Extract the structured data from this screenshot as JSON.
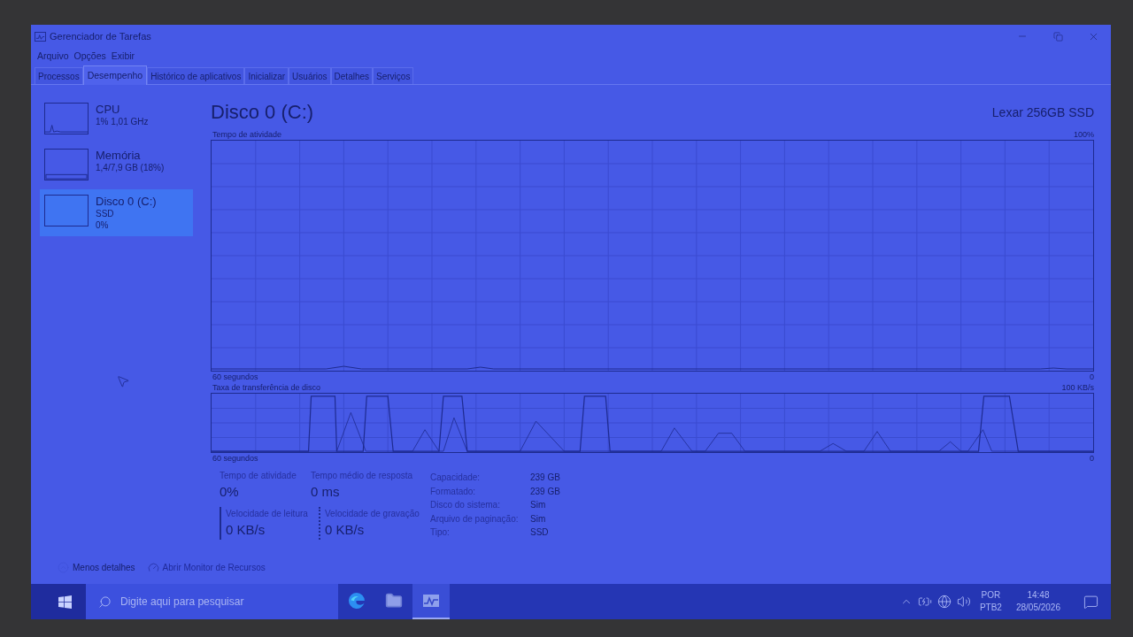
{
  "window": {
    "title": "Gerenciador de Tarefas"
  },
  "menu": [
    "Arquivo",
    "Opções",
    "Exibir"
  ],
  "tabs": [
    {
      "label": "Processos",
      "selected": false
    },
    {
      "label": "Desempenho",
      "selected": true
    },
    {
      "label": "Histórico de aplicativos",
      "selected": false
    },
    {
      "label": "Inicializar",
      "selected": false
    },
    {
      "label": "Usuários",
      "selected": false
    },
    {
      "label": "Detalhes",
      "selected": false
    },
    {
      "label": "Serviços",
      "selected": false
    }
  ],
  "sidebar": {
    "items": [
      {
        "kind": "cpu",
        "name": "CPU",
        "details": [
          "1% 1,01 GHz"
        ],
        "selected": false
      },
      {
        "kind": "memory",
        "name": "Memória",
        "details": [
          "1,4/7,9 GB (18%)"
        ],
        "selected": false
      },
      {
        "kind": "disk",
        "name": "Disco 0 (C:)",
        "details": [
          "SSD",
          "0%"
        ],
        "selected": true
      }
    ]
  },
  "main": {
    "title": "Disco 0 (C:)",
    "device": "Lexar 256GB SSD",
    "charts": [
      {
        "kind": "activity",
        "label": "Tempo de atividade",
        "max": "100%",
        "time_span": "60 segundos",
        "min": "0"
      },
      {
        "kind": "transfer",
        "label": "Taxa de transferência de disco",
        "max": "100 KB/s",
        "time_span": "60 segundos",
        "min": "0"
      }
    ],
    "stats": [
      {
        "label": "Tempo de atividade",
        "value": "0%"
      },
      {
        "label": "Tempo médio de resposta",
        "value": "0 ms"
      }
    ],
    "speeds": [
      {
        "kind": "read",
        "label": "Velocidade de leitura",
        "value": "0 KB/s"
      },
      {
        "kind": "write",
        "label": "Velocidade de gravação",
        "value": "0 KB/s"
      }
    ],
    "properties": [
      {
        "label": "Capacidade:",
        "value": "239 GB"
      },
      {
        "label": "Formatado:",
        "value": "239 GB"
      },
      {
        "label": "Disco do sistema:",
        "value": "Sim"
      },
      {
        "label": "Arquivo de paginação:",
        "value": "Sim"
      },
      {
        "label": "Tipo:",
        "value": "SSD"
      }
    ]
  },
  "footer": {
    "toggle": "Menos detalhes",
    "link": "Abrir Monitor de Recursos"
  },
  "taskbar": {
    "search": {
      "placeholder": "Digite aqui para pesquisar"
    },
    "apps": [
      {
        "kind": "browser",
        "selected": false
      },
      {
        "kind": "folder",
        "selected": false
      },
      {
        "kind": "task-manager",
        "selected": true
      }
    ],
    "language": [
      "POR",
      "PTB2"
    ],
    "time": "14:48",
    "date": "28/05/2026"
  }
}
